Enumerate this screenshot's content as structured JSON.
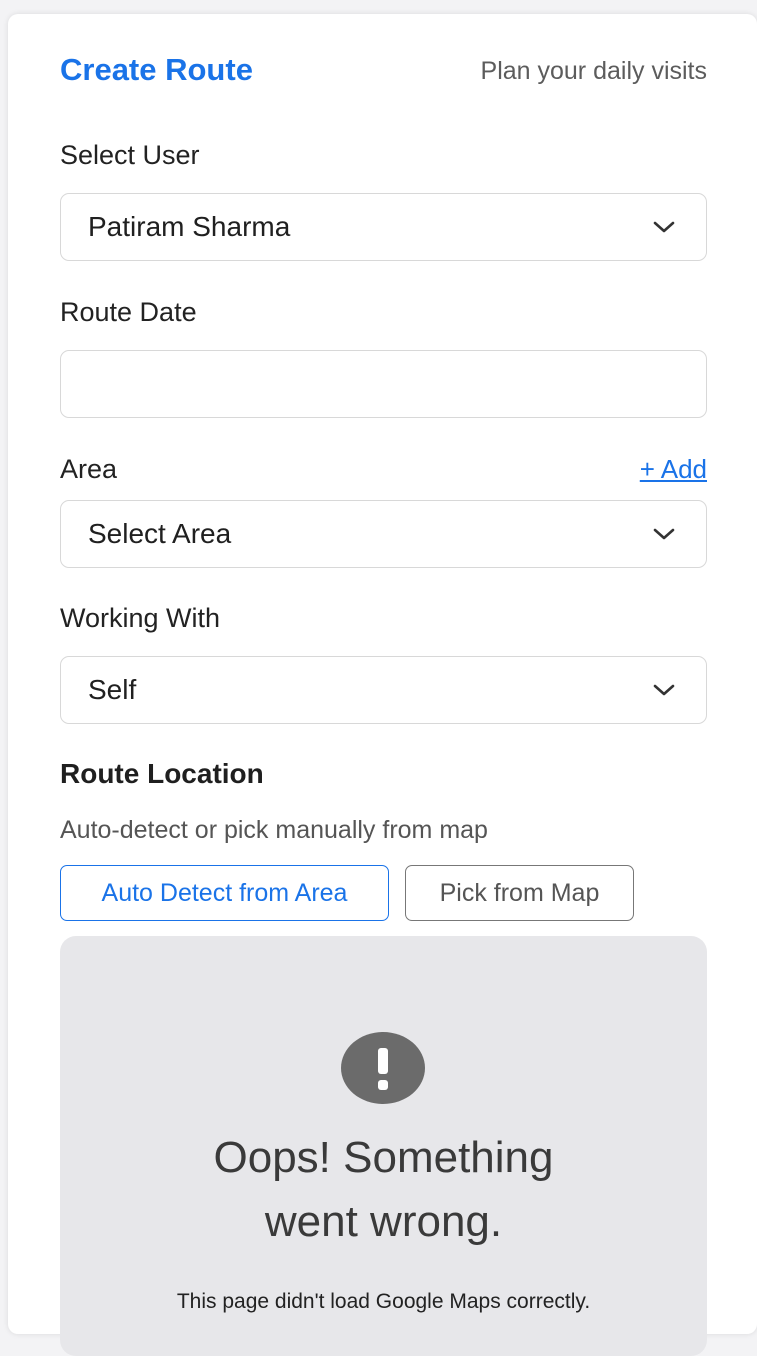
{
  "header": {
    "title": "Create Route",
    "subtitle": "Plan your daily visits"
  },
  "form": {
    "user_label": "Select User",
    "user_value": "Patiram Sharma",
    "date_label": "Route Date",
    "date_value": "",
    "area_label": "Area",
    "area_add": "+ Add",
    "area_value": "Select Area",
    "working_label": "Working With",
    "working_value": "Self"
  },
  "location": {
    "title": "Route Location",
    "helper": "Auto-detect or pick manually from map",
    "auto_button": "Auto Detect from Area",
    "map_button": "Pick from Map"
  },
  "map_error": {
    "icon": "exclamation-icon",
    "title_line1": "Oops! Something",
    "title_line2": "went wrong.",
    "message": "This page didn't load Google Maps correctly."
  },
  "colors": {
    "accent": "#1a73e8",
    "map_bg": "#e7e7ea",
    "error_icon_bg": "#6b6b6b"
  }
}
